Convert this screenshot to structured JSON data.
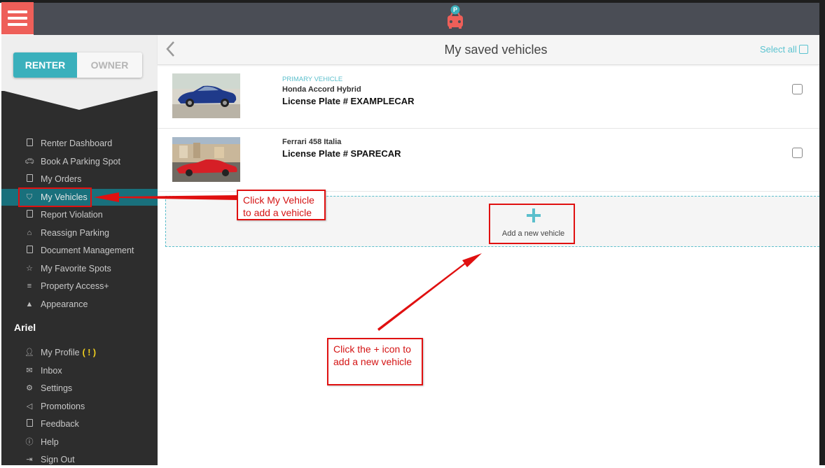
{
  "topbar": {
    "menu_icon": "hamburger-icon",
    "logo_icon": "parking-car-logo",
    "logo_badge": "P"
  },
  "sidebar": {
    "toggle": {
      "renter": "RENTER",
      "owner": "OWNER"
    },
    "items": [
      {
        "label": "Renter Dashboard",
        "icon": "dashboard-icon"
      },
      {
        "label": "Book A Parking Spot",
        "icon": "car-icon"
      },
      {
        "label": "My Orders",
        "icon": "orders-icon"
      },
      {
        "label": "My Vehicles",
        "icon": "car-front-icon"
      },
      {
        "label": "Report Violation",
        "icon": "report-icon"
      },
      {
        "label": "Reassign Parking",
        "icon": "home-icon"
      },
      {
        "label": "Document Management",
        "icon": "document-icon"
      },
      {
        "label": "My Favorite Spots",
        "icon": "star-icon"
      },
      {
        "label": "Property Access+",
        "icon": "property-icon"
      },
      {
        "label": "Appearance",
        "icon": "appearance-icon"
      }
    ],
    "user_name": "Ariel",
    "account_items": [
      {
        "label": "My Profile",
        "icon": "user-icon",
        "badge": "( ! )"
      },
      {
        "label": "Inbox",
        "icon": "envelope-icon"
      },
      {
        "label": "Settings",
        "icon": "gear-icon"
      },
      {
        "label": "Promotions",
        "icon": "megaphone-icon"
      },
      {
        "label": "Feedback",
        "icon": "feedback-icon"
      },
      {
        "label": "Help",
        "icon": "help-icon"
      },
      {
        "label": "Sign Out",
        "icon": "sign-out-icon"
      }
    ]
  },
  "main": {
    "title": "My saved vehicles",
    "select_all": "Select all",
    "vehicles": [
      {
        "tag": "PRIMARY VEHICLE",
        "model": "Honda Accord Hybrid",
        "plate": "License Plate # EXAMPLECAR",
        "color": "#1f3a8a"
      },
      {
        "tag": "",
        "model": "Ferrari 458 Italia",
        "plate": "License Plate # SPARECAR",
        "color": "#d61f26"
      }
    ],
    "add_vehicle": "Add a new vehicle"
  },
  "annotations": {
    "callout_vehicles": [
      "Click My Vehicle",
      "to add a vehicle"
    ],
    "callout_plus": [
      "Click the + icon to",
      "add a new vehicle"
    ]
  },
  "colors": {
    "accent": "#3ab0bc",
    "active_nav": "#19707c",
    "brand_red": "#ee5f59",
    "annotation_red": "#e01010"
  }
}
